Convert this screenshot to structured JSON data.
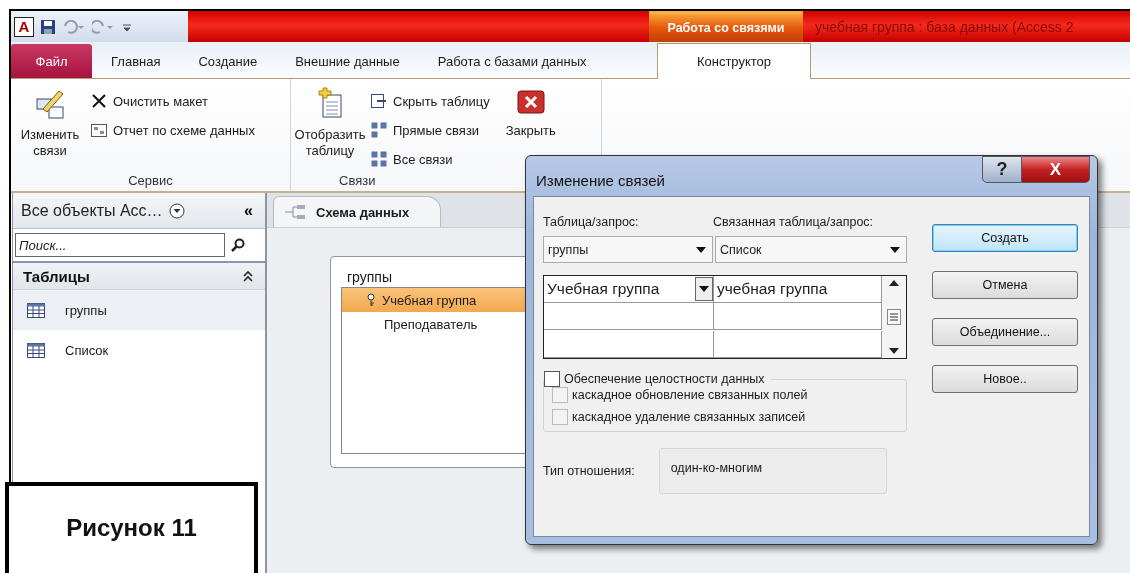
{
  "title_bar": {
    "app_letter": "A",
    "context_tab": "Работа со связями",
    "title": "учебная группа : база данных (Access 2"
  },
  "ribbon_tabs": [
    {
      "label": "Файл",
      "kind": "file",
      "selected": false
    },
    {
      "label": "Главная",
      "kind": "tab",
      "selected": false
    },
    {
      "label": "Создание",
      "kind": "tab",
      "selected": false
    },
    {
      "label": "Внешние данные",
      "kind": "tab",
      "selected": false
    },
    {
      "label": "Работа с базами данных",
      "kind": "tab",
      "selected": false
    },
    {
      "label": "Конструктор",
      "kind": "context",
      "selected": true
    }
  ],
  "ribbon_groups": [
    {
      "label": "Сервис",
      "items": [
        {
          "kind": "large",
          "label": "Изменить связи"
        },
        {
          "kind": "small",
          "label": "Очистить макет"
        },
        {
          "kind": "small",
          "label": "Отчет по схеме данных"
        }
      ]
    },
    {
      "label": "Связи",
      "items": [
        {
          "kind": "large",
          "label": "Отобразить таблицу"
        },
        {
          "kind": "small",
          "label": "Скрыть таблицу"
        },
        {
          "kind": "small",
          "label": "Прямые связи"
        },
        {
          "kind": "small",
          "label": "Все связи"
        },
        {
          "kind": "large",
          "label": "Закрыть"
        }
      ]
    }
  ],
  "nav_pane": {
    "title": "Все объекты Acc…",
    "collapse": "«",
    "search": {
      "placeholder": "Поиск..."
    },
    "group": {
      "label": "Таблицы",
      "expanded": true,
      "items": [
        {
          "label": "группы",
          "selected": true
        },
        {
          "label": "Список",
          "selected": false
        }
      ]
    }
  },
  "document_tab": {
    "label": "Схема данных",
    "selected": true
  },
  "field_list": {
    "title": "группы",
    "fields": [
      {
        "name": "Учебная группа",
        "key": true,
        "selected": true
      },
      {
        "name": "Преподаватель",
        "key": false,
        "selected": false
      }
    ]
  },
  "dialog": {
    "title": "Изменение связей",
    "help_button": "?",
    "close_button": "X",
    "table_label": "Таблица/запрос:",
    "related_label": "Связанная таблица/запрос:",
    "table_value": "группы",
    "related_value": "Список",
    "join_rows": [
      {
        "left": "Учебная группа",
        "right": "учебная группа"
      }
    ],
    "checkboxes": [
      {
        "label": "Обеспечение целостности данных",
        "checked": false,
        "disabled": false
      },
      {
        "label": "каскадное обновление связанных полей",
        "checked": false,
        "disabled": true
      },
      {
        "label": "каскадное удаление связанных записей",
        "checked": false,
        "disabled": true
      }
    ],
    "relation_label": "Тип отношения:",
    "relation_value": "один-ко-многим",
    "buttons": [
      {
        "label": "Создать",
        "default": true
      },
      {
        "label": "Отмена",
        "default": false
      },
      {
        "label": "Объединение...",
        "default": false
      },
      {
        "label": "Новое..",
        "default": false
      }
    ]
  },
  "caption": "Рисунок 11"
}
